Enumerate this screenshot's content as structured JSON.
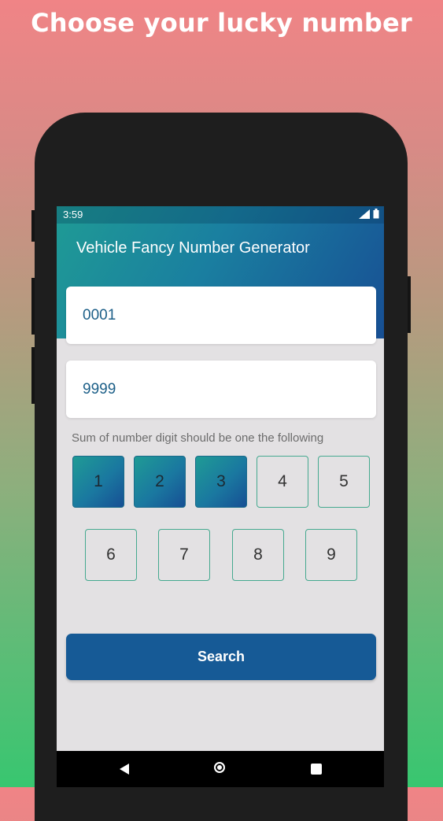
{
  "promo": {
    "title": "Choose your lucky number"
  },
  "status_bar": {
    "time": "3:59",
    "icons": [
      "signal-icon",
      "battery-icon"
    ]
  },
  "app": {
    "title": "Vehicle Fancy Number Generator",
    "from_field": {
      "value": "0001"
    },
    "to_field": {
      "value": "9999"
    },
    "hint": "Sum of number digit should be one the following",
    "digits": [
      {
        "label": "1",
        "selected": true
      },
      {
        "label": "2",
        "selected": true
      },
      {
        "label": "3",
        "selected": true
      },
      {
        "label": "4",
        "selected": false
      },
      {
        "label": "5",
        "selected": false
      },
      {
        "label": "6",
        "selected": false
      },
      {
        "label": "7",
        "selected": false
      },
      {
        "label": "8",
        "selected": false
      },
      {
        "label": "9",
        "selected": false
      }
    ],
    "search_label": "Search"
  },
  "colors": {
    "accent": "#165a96",
    "teal": "#1f9b95",
    "outline": "#45a98f"
  },
  "nav_bar": {
    "icons": [
      "back-icon",
      "home-icon",
      "recents-icon"
    ]
  }
}
